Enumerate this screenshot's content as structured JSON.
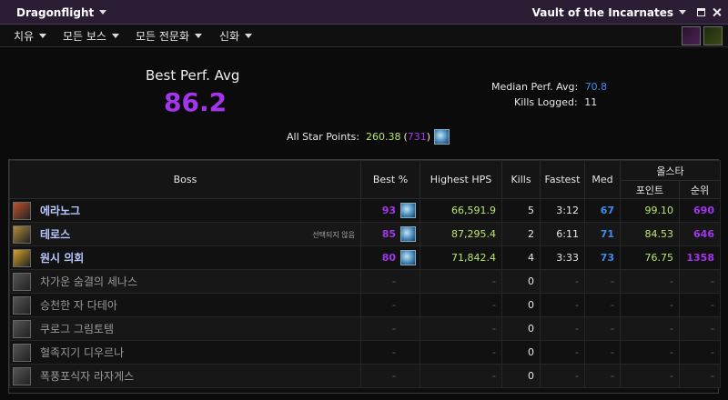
{
  "topbar": {
    "expansion": "Dragonflight",
    "raid": "Vault of the Incarnates"
  },
  "menu": {
    "items": [
      {
        "label": "치유"
      },
      {
        "label": "모든 보스"
      },
      {
        "label": "모든 전문화"
      },
      {
        "label": "신화"
      }
    ]
  },
  "summary": {
    "best_perf_label": "Best Perf. Avg",
    "best_perf_value": "86.2",
    "median_label": "Median Perf. Avg:",
    "median_value": "70.8",
    "kills_label": "Kills Logged:",
    "kills_value": "11",
    "allstar_label": "All Star Points:",
    "allstar_points": "260.38",
    "allstar_rank_open": "(",
    "allstar_rank": "731",
    "allstar_rank_close": ")"
  },
  "table": {
    "headers": {
      "boss": "Boss",
      "best": "Best %",
      "hps": "Highest HPS",
      "kills": "Kills",
      "fastest": "Fastest",
      "med": "Med",
      "allstar": "올스타",
      "points": "포인트",
      "rank": "순위"
    },
    "rows": [
      {
        "name": "에라노그",
        "note": "",
        "best": "93",
        "hps": "66,591.9",
        "kills": "5",
        "fastest": "3:12",
        "med": "67",
        "points": "99.10",
        "rank": "690",
        "icon": "eranog-icon",
        "icon_color": "#c0502a",
        "active": true
      },
      {
        "name": "테로스",
        "note": "선택되지 않음",
        "best": "85",
        "hps": "87,295.4",
        "kills": "2",
        "fastest": "6:11",
        "med": "71",
        "points": "84.53",
        "rank": "646",
        "icon": "terros-icon",
        "icon_color": "#b08a3a",
        "active": true
      },
      {
        "name": "원시 의회",
        "note": "",
        "best": "80",
        "hps": "71,842.4",
        "kills": "4",
        "fastest": "3:33",
        "med": "73",
        "points": "76.75",
        "rank": "1358",
        "icon": "council-icon",
        "icon_color": "#d6a22a",
        "active": true
      },
      {
        "name": "차가운 숨결의 세나스",
        "note": "",
        "best": "-",
        "hps": "-",
        "kills": "0",
        "fastest": "-",
        "med": "-",
        "points": "-",
        "rank": "-",
        "icon": "sennarth-icon",
        "icon_color": "#555555",
        "active": false
      },
      {
        "name": "승천한 자 다테아",
        "note": "",
        "best": "-",
        "hps": "-",
        "kills": "0",
        "fastest": "-",
        "med": "-",
        "points": "-",
        "rank": "-",
        "icon": "dathea-icon",
        "icon_color": "#555555",
        "active": false
      },
      {
        "name": "쿠로그 그림토템",
        "note": "",
        "best": "-",
        "hps": "-",
        "kills": "0",
        "fastest": "-",
        "med": "-",
        "points": "-",
        "rank": "-",
        "icon": "kurog-icon",
        "icon_color": "#555555",
        "active": false
      },
      {
        "name": "혈족지기 디우르나",
        "note": "",
        "best": "-",
        "hps": "-",
        "kills": "0",
        "fastest": "-",
        "med": "-",
        "points": "-",
        "rank": "-",
        "icon": "diurna-icon",
        "icon_color": "#555555",
        "active": false
      },
      {
        "name": "폭풍포식자 라자게스",
        "note": "",
        "best": "-",
        "hps": "-",
        "kills": "0",
        "fastest": "-",
        "med": "-",
        "points": "-",
        "rank": "-",
        "icon": "raszageth-icon",
        "icon_color": "#555555",
        "active": false
      }
    ]
  },
  "colors": {
    "purple": "#a335ee",
    "blue": "#3b8cf0",
    "green": "#b8e66d",
    "topbar": "#2b1d33"
  }
}
